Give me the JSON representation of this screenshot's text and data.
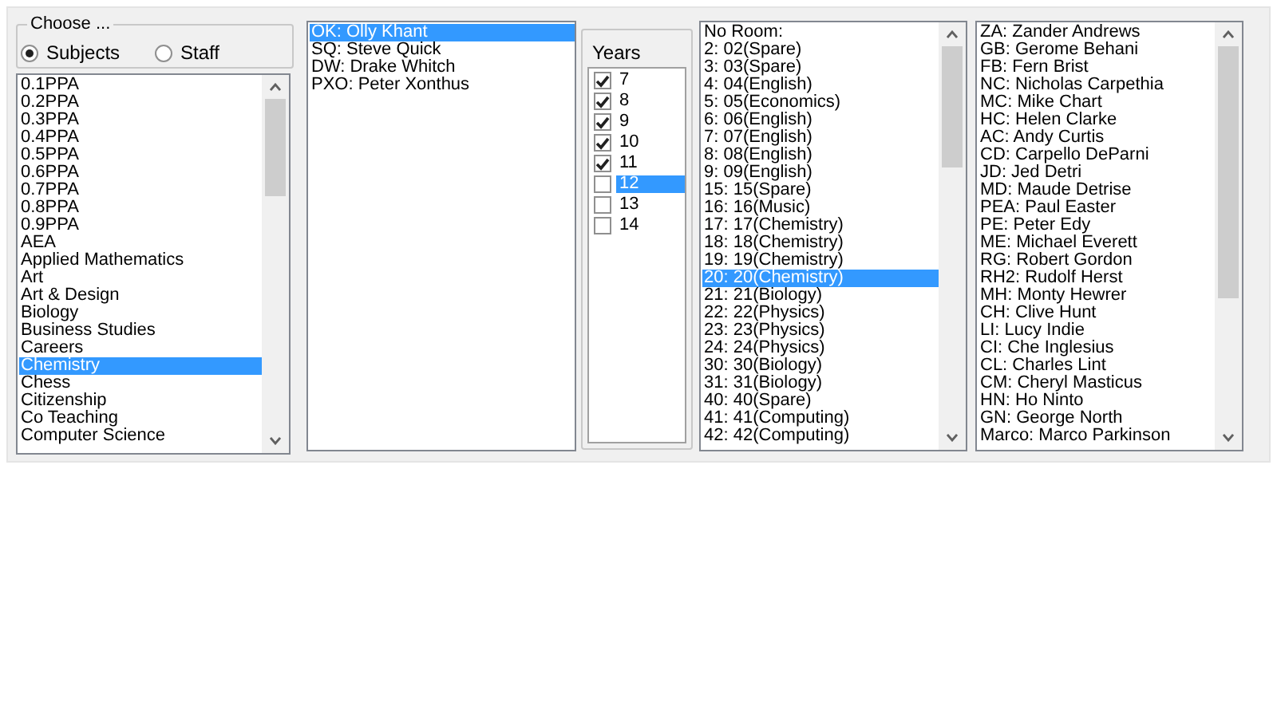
{
  "choose": {
    "title": "Choose ...",
    "options": [
      {
        "label": "Subjects",
        "selected": true
      },
      {
        "label": "Staff",
        "selected": false
      }
    ]
  },
  "subjects": {
    "items": [
      {
        "label": "0.1PPA",
        "selected": false
      },
      {
        "label": "0.2PPA",
        "selected": false
      },
      {
        "label": "0.3PPA",
        "selected": false
      },
      {
        "label": "0.4PPA",
        "selected": false
      },
      {
        "label": "0.5PPA",
        "selected": false
      },
      {
        "label": "0.6PPA",
        "selected": false
      },
      {
        "label": "0.7PPA",
        "selected": false
      },
      {
        "label": "0.8PPA",
        "selected": false
      },
      {
        "label": "0.9PPA",
        "selected": false
      },
      {
        "label": "AEA",
        "selected": false
      },
      {
        "label": "Applied Mathematics",
        "selected": false
      },
      {
        "label": "Art",
        "selected": false
      },
      {
        "label": "Art & Design",
        "selected": false
      },
      {
        "label": "Biology",
        "selected": false
      },
      {
        "label": "Business Studies",
        "selected": false
      },
      {
        "label": "Careers",
        "selected": false
      },
      {
        "label": "Chemistry",
        "selected": true
      },
      {
        "label": "Chess",
        "selected": false
      },
      {
        "label": "Citizenship",
        "selected": false
      },
      {
        "label": "Co Teaching",
        "selected": false
      },
      {
        "label": "Computer Science",
        "selected": false
      }
    ]
  },
  "subject_staff": {
    "items": [
      {
        "label": "OK: Olly Khant",
        "selected": true
      },
      {
        "label": "SQ: Steve Quick",
        "selected": false
      },
      {
        "label": "DW: Drake Whitch",
        "selected": false
      },
      {
        "label": "PXO: Peter Xonthus",
        "selected": false
      }
    ]
  },
  "years": {
    "title": "Years",
    "items": [
      {
        "label": "7",
        "checked": true,
        "selected": false
      },
      {
        "label": "8",
        "checked": true,
        "selected": false
      },
      {
        "label": "9",
        "checked": true,
        "selected": false
      },
      {
        "label": "10",
        "checked": true,
        "selected": false
      },
      {
        "label": "11",
        "checked": true,
        "selected": false
      },
      {
        "label": "12",
        "checked": false,
        "selected": true
      },
      {
        "label": "13",
        "checked": false,
        "selected": false
      },
      {
        "label": "14",
        "checked": false,
        "selected": false
      }
    ]
  },
  "rooms": {
    "items": [
      {
        "label": "No Room:",
        "selected": false
      },
      {
        "label": "2: 02(Spare)",
        "selected": false
      },
      {
        "label": "3: 03(Spare)",
        "selected": false
      },
      {
        "label": "4: 04(English)",
        "selected": false
      },
      {
        "label": "5: 05(Economics)",
        "selected": false
      },
      {
        "label": "6: 06(English)",
        "selected": false
      },
      {
        "label": "7: 07(English)",
        "selected": false
      },
      {
        "label": "8: 08(English)",
        "selected": false
      },
      {
        "label": "9: 09(English)",
        "selected": false
      },
      {
        "label": "15: 15(Spare)",
        "selected": false
      },
      {
        "label": "16: 16(Music)",
        "selected": false
      },
      {
        "label": "17: 17(Chemistry)",
        "selected": false
      },
      {
        "label": "18: 18(Chemistry)",
        "selected": false
      },
      {
        "label": "19: 19(Chemistry)",
        "selected": false
      },
      {
        "label": "20: 20(Chemistry)",
        "selected": true
      },
      {
        "label": "21: 21(Biology)",
        "selected": false
      },
      {
        "label": "22: 22(Physics)",
        "selected": false
      },
      {
        "label": "23: 23(Physics)",
        "selected": false
      },
      {
        "label": "24: 24(Physics)",
        "selected": false
      },
      {
        "label": "30: 30(Biology)",
        "selected": false
      },
      {
        "label": "31: 31(Biology)",
        "selected": false
      },
      {
        "label": "40: 40(Spare)",
        "selected": false
      },
      {
        "label": "41: 41(Computing)",
        "selected": false
      },
      {
        "label": "42: 42(Computing)",
        "selected": false
      }
    ]
  },
  "all_staff": {
    "items": [
      {
        "label": "ZA: Zander Andrews",
        "selected": false
      },
      {
        "label": "GB: Gerome Behani",
        "selected": false
      },
      {
        "label": "FB: Fern Brist",
        "selected": false
      },
      {
        "label": "NC: Nicholas Carpethia",
        "selected": false
      },
      {
        "label": "MC: Mike Chart",
        "selected": false
      },
      {
        "label": "HC: Helen Clarke",
        "selected": false
      },
      {
        "label": "AC: Andy Curtis",
        "selected": false
      },
      {
        "label": "CD: Carpello DeParni",
        "selected": false
      },
      {
        "label": "JD: Jed Detri",
        "selected": false
      },
      {
        "label": "MD: Maude Detrise",
        "selected": false
      },
      {
        "label": "PEA: Paul Easter",
        "selected": false
      },
      {
        "label": "PE: Peter Edy",
        "selected": false
      },
      {
        "label": "ME: Michael Everett",
        "selected": false
      },
      {
        "label": "RG: Robert Gordon",
        "selected": false
      },
      {
        "label": "RH2: Rudolf Herst",
        "selected": false
      },
      {
        "label": "MH: Monty Hewrer",
        "selected": false
      },
      {
        "label": "CH: Clive Hunt",
        "selected": false
      },
      {
        "label": "LI: Lucy Indie",
        "selected": false
      },
      {
        "label": "CI: Che Inglesius",
        "selected": false
      },
      {
        "label": "CL: Charles Lint",
        "selected": false
      },
      {
        "label": "CM: Cheryl Masticus",
        "selected": false
      },
      {
        "label": "HN: Ho Ninto",
        "selected": false
      },
      {
        "label": "GN: George North",
        "selected": false
      },
      {
        "label": "Marco: Marco Parkinson",
        "selected": false
      }
    ]
  }
}
